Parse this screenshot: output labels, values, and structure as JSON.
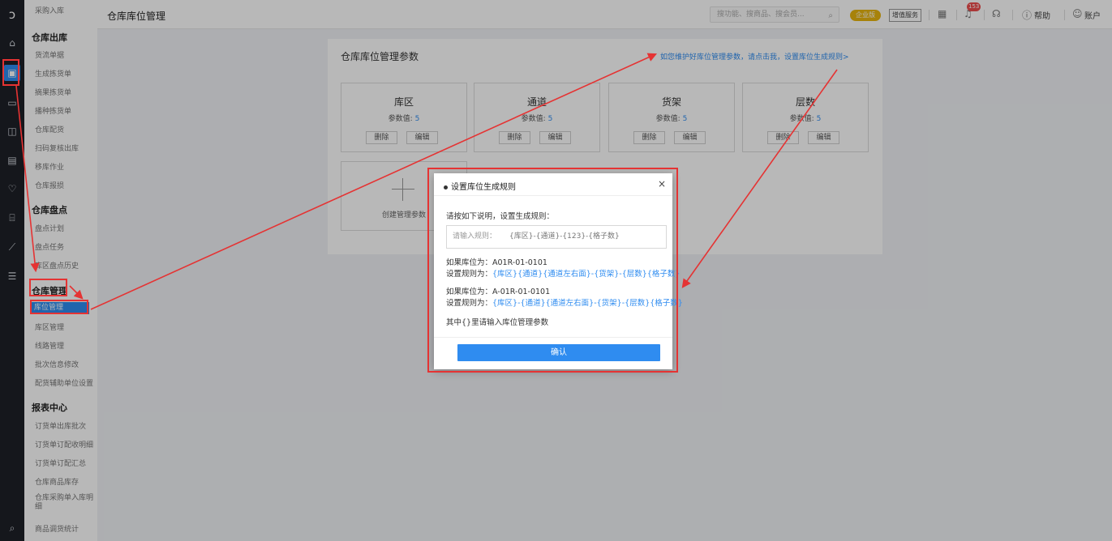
{
  "rail": {
    "icons": [
      "logo-icon",
      "home-icon",
      "warehouse-icon",
      "purchase-icon",
      "package-icon",
      "finance-icon",
      "member-icon",
      "bank-icon",
      "report-icon",
      "menu-icon",
      "search-icon"
    ]
  },
  "menu": {
    "top_item": "采购入库",
    "groups": [
      {
        "label": "仓库出库",
        "items": [
          "货流单据",
          "生成拣货单",
          "摘果拣货单",
          "播种拣货单",
          "仓库配货",
          "扫码复核出库",
          "移库作业",
          "仓库报损"
        ]
      },
      {
        "label": "仓库盘点",
        "items": [
          "盘点计划",
          "盘点任务",
          "库区盘点历史"
        ]
      },
      {
        "label": "仓库管理",
        "items": [
          "库位管理",
          "库区管理",
          "线路管理",
          "批次信息修改",
          "配货辅助单位设置"
        ]
      },
      {
        "label": "报表中心",
        "items": [
          "订货单出库批次",
          "订货单订配收明细",
          "订货单订配汇总",
          "仓库商品库存",
          "仓库采购单入库明细",
          "商品调货统计"
        ]
      }
    ],
    "active_item": "库位管理"
  },
  "topbar": {
    "title": "仓库库位管理",
    "search_placeholder": "搜功能、搜商品、搜会员...",
    "edition_badge": "企业版",
    "value_added": "增值服务",
    "notify_count": "153",
    "help": "帮助",
    "account": "账户"
  },
  "main": {
    "section_title": "仓库库位管理参数",
    "hint_link": "如您维护好库位管理参数，请点击我，设置库位生成规则>",
    "value_label": "参数值:",
    "cards": [
      {
        "name": "库区",
        "value": "5"
      },
      {
        "name": "通道",
        "value": "5"
      },
      {
        "name": "货架",
        "value": "5"
      },
      {
        "name": "层数",
        "value": "5"
      }
    ],
    "delete_label": "删除",
    "edit_label": "编辑",
    "create_label": "创建管理参数"
  },
  "modal": {
    "title": "设置库位生成规则",
    "instruction": "请按如下说明，设置生成规则：",
    "input_placeholder": "请输入规则：",
    "input_example": "{库区}-{通道}-{123}-{格子数}",
    "example1_label": "如果库位为：A01R-01-0101",
    "example1_rule_prefix": "设置规则为：",
    "example1_rule": "{库区}{通道}{通道左右面}-{货架}-{层数}{格子数}",
    "example2_label": "如果库位为：A-01R-01-0101",
    "example2_rule_prefix": "设置规则为：",
    "example2_rule": "{库区}-{通道}{通道左右面}-{货架}-{层数}{格子数}",
    "note": "其中{}里请输入库位管理参数",
    "confirm": "确认"
  },
  "colors": {
    "primary": "#2f8cf0",
    "annotation": "#e53333",
    "rail_bg": "#1e2127",
    "badge": "#e8b40e"
  }
}
